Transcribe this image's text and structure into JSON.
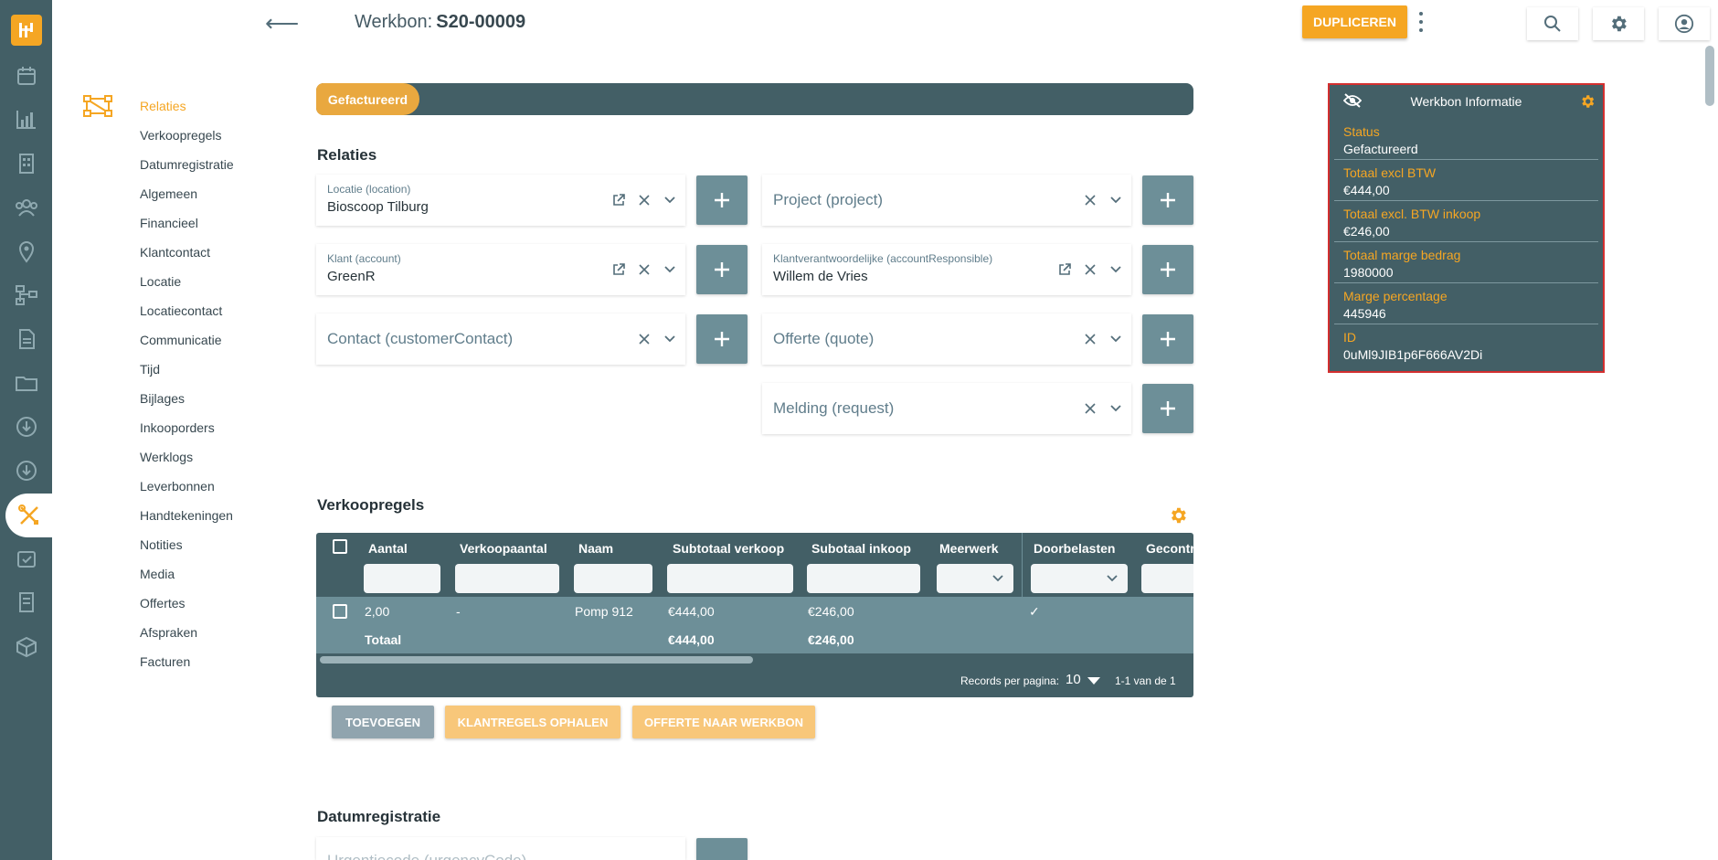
{
  "header": {
    "title_prefix": "Werkbon:",
    "title_id": "S20-00009",
    "duplicate_label": "DUPLICEREN"
  },
  "status": {
    "label": "Gefactureerd"
  },
  "nav": {
    "items": [
      "Relaties",
      "Verkoopregels",
      "Datumregistratie",
      "Algemeen",
      "Financieel",
      "Klantcontact",
      "Locatie",
      "Locatiecontact",
      "Communicatie",
      "Tijd",
      "Bijlages",
      "Inkooporders",
      "Werklogs",
      "Leverbonnen",
      "Handtekeningen",
      "Notities",
      "Media",
      "Offertes",
      "Afspraken",
      "Facturen"
    ]
  },
  "relaties": {
    "title": "Relaties",
    "location": {
      "label": "Locatie (location)",
      "value": "Bioscoop Tilburg"
    },
    "project": {
      "placeholder": "Project (project)"
    },
    "account": {
      "label": "Klant (account)",
      "value": "GreenR"
    },
    "responsible": {
      "label": "Klantverantwoordelijke (accountResponsible)",
      "value": "Willem de Vries"
    },
    "contact": {
      "placeholder": "Contact (customerContact)"
    },
    "quote": {
      "placeholder": "Offerte (quote)"
    },
    "request": {
      "placeholder": "Melding (request)"
    }
  },
  "verkoopregels": {
    "title": "Verkoopregels",
    "columns": [
      "Aantal",
      "Verkoopaantal",
      "Naam",
      "Subtotaal verkoop",
      "Subotaal inkoop",
      "Meerwerk",
      "Doorbelasten",
      "Gecontr"
    ],
    "row": {
      "aantal": "2,00",
      "verkoopaantal": "-",
      "naam": "Pomp 912",
      "subtotaal_verkoop": "€444,00",
      "subtotaal_inkoop": "€246,00",
      "doorbelasten": "✓"
    },
    "total": {
      "label": "Totaal",
      "subtotaal_verkoop": "€444,00",
      "subtotaal_inkoop": "€246,00"
    },
    "footer": {
      "records_label": "Records per pagina:",
      "records_value": "10",
      "range": "1-1 van de 1"
    },
    "buttons": {
      "add": "TOEVOEGEN",
      "fetch": "KLANTREGELS OPHALEN",
      "quote": "OFFERTE NAAR WERKBON"
    }
  },
  "datumregistratie": {
    "title": "Datumregistratie",
    "field_placeholder": "Urgentiecode (urgencyCode)"
  },
  "info": {
    "title": "Werkbon Informatie",
    "items": [
      {
        "key": "Status",
        "value": "Gefactureerd"
      },
      {
        "key": "Totaal excl BTW",
        "value": "€444,00"
      },
      {
        "key": "Totaal excl. BTW inkoop",
        "value": "€246,00"
      },
      {
        "key": "Totaal marge bedrag",
        "value": "1980000"
      },
      {
        "key": "Marge percentage",
        "value": "445946"
      },
      {
        "key": "ID",
        "value": "0uMl9JIB1p6F666AV2Di"
      }
    ]
  },
  "colors": {
    "accent": "#f5a623",
    "primary": "#435f66",
    "button": "#6d8f98",
    "highlight": "#d32f2f"
  }
}
